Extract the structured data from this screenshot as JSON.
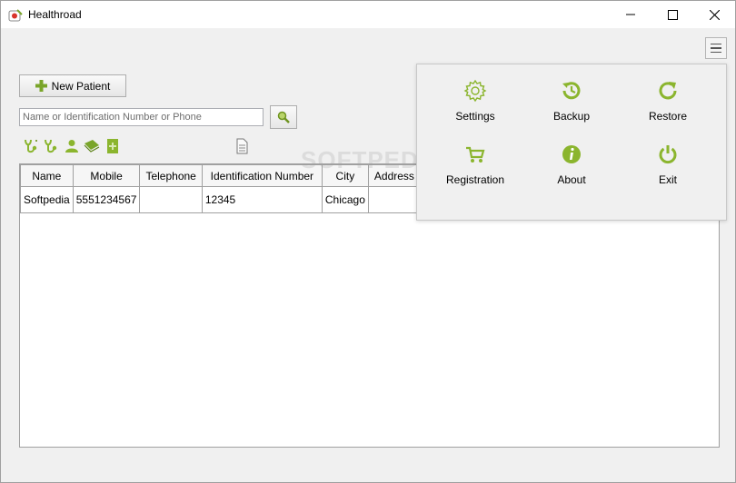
{
  "window": {
    "title": "Healthroad"
  },
  "actions": {
    "new_patient_label": "New Patient"
  },
  "search": {
    "placeholder": "Name or Identification Number or Phone",
    "value": ""
  },
  "watermark": "SOFTPEDIA",
  "table": {
    "columns": [
      "Name",
      "Mobile",
      "Telephone",
      "Identification Number",
      "City",
      "Address"
    ],
    "rows": [
      [
        "Softpedia",
        "5551234567",
        "",
        "12345",
        "Chicago",
        ""
      ]
    ]
  },
  "menu": {
    "items": [
      {
        "label": "Settings",
        "icon": "gear-icon"
      },
      {
        "label": "Backup",
        "icon": "history-icon"
      },
      {
        "label": "Restore",
        "icon": "refresh-icon"
      },
      {
        "label": "Registration",
        "icon": "cart-icon"
      },
      {
        "label": "About",
        "icon": "info-icon"
      },
      {
        "label": "Exit",
        "icon": "power-icon"
      }
    ]
  },
  "colors": {
    "accent": "#8bb52e",
    "accent_dark": "#6f9420"
  }
}
